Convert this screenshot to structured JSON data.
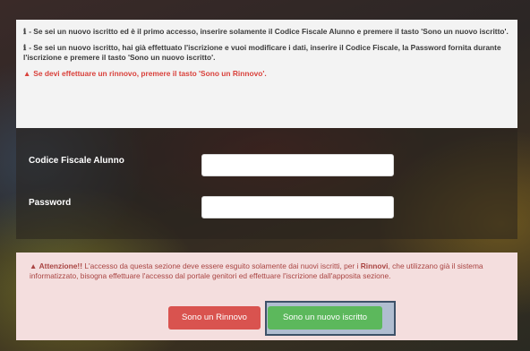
{
  "info": {
    "icon_glyph": "ℹ",
    "line1": "- Se sei un nuovo iscritto ed è il primo accesso, inserire solamente il Codice Fiscale Alunno e premere il tasto 'Sono un nuovo iscritto'.",
    "line2": "- Se sei un nuovo iscritto, hai già effettuato l'iscrizione e vuoi modificare i dati, inserire il Codice Fiscale, la Password fornita durante l'iscrizione e premere il tasto 'Sono un nuovo iscritto'.",
    "warning_glyph": "▲",
    "warning": "Se devi effettuare un rinnovo, premere il tasto 'Sono un Rinnovo'."
  },
  "form": {
    "codice_fiscale_label": "Codice Fiscale Alunno",
    "codice_fiscale_value": "",
    "password_label": "Password",
    "password_value": ""
  },
  "alert": {
    "icon_glyph": "▲",
    "strong": "Attenzione!!",
    "text_part1": " L'accesso da questa sezione deve essere esguito solamente dai nuovi iscritti, per i ",
    "strong2": "Rinnovi",
    "text_part2": ", che utilizzano già il sistema informatizzato, bisogna effettuare l'accesso dal portale genitori ed effettuare l'iscrizione dall'apposita sezione."
  },
  "buttons": {
    "rinnovo": "Sono un Rinnovo",
    "nuovo": "Sono un nuovo iscritto"
  },
  "colors": {
    "danger": "#d9534f",
    "success": "#5cb85c",
    "alert_bg": "#f4dede",
    "alert_text": "#a94442"
  }
}
